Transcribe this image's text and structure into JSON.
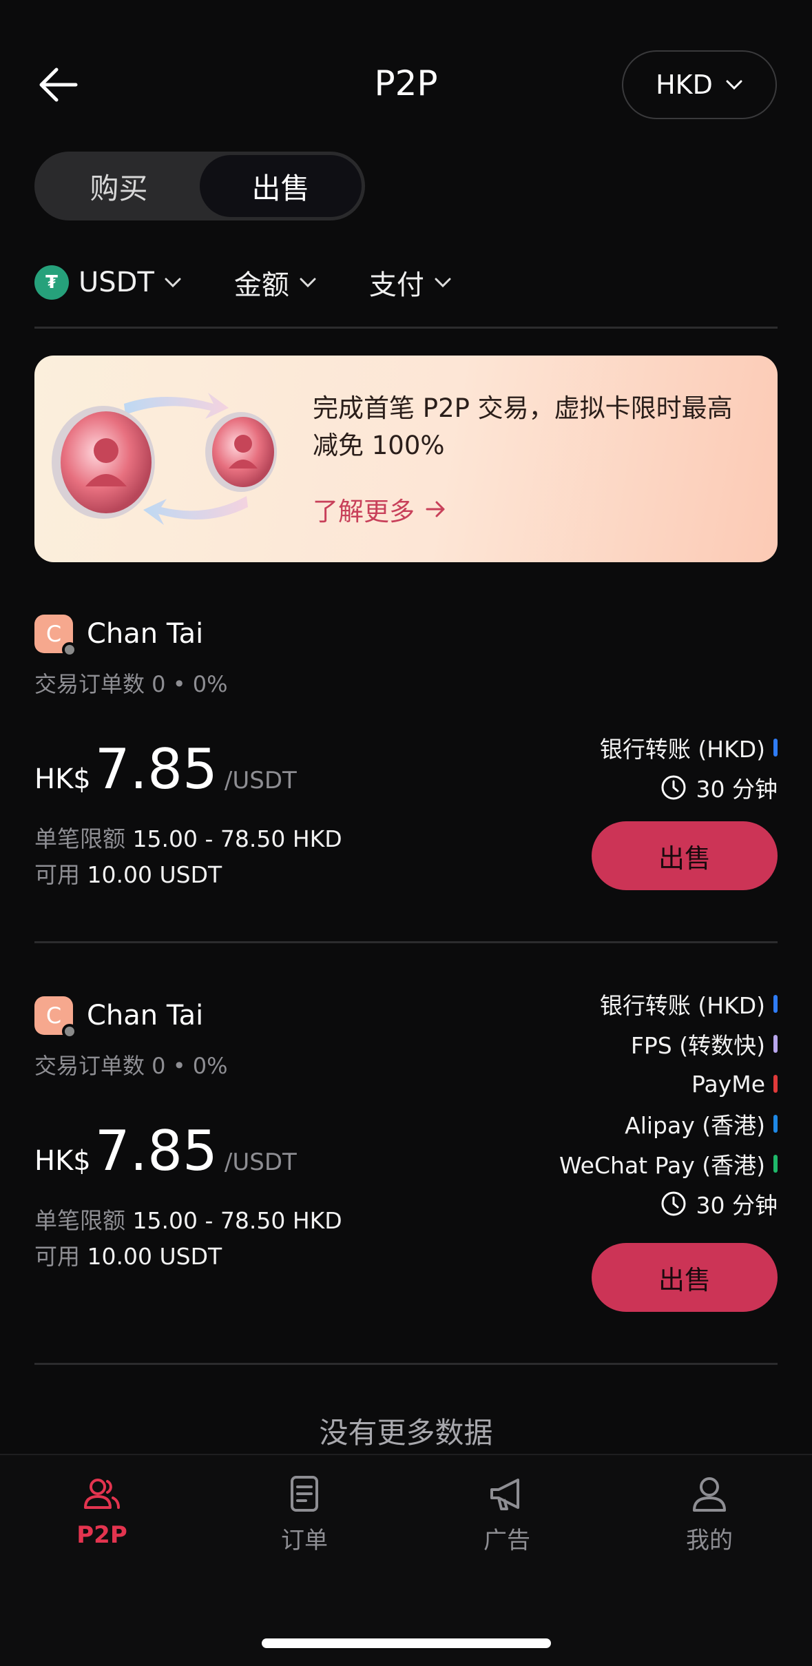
{
  "header": {
    "title": "P2P",
    "currency": "HKD"
  },
  "segment": {
    "buy_label": "购买",
    "sell_label": "出售",
    "active": "sell"
  },
  "filters": {
    "crypto": "USDT",
    "amount": "金额",
    "payment": "支付"
  },
  "banner": {
    "text": "完成首笔 P2P 交易，虚拟卡限时最高减免 100%",
    "link": "了解更多"
  },
  "listings": [
    {
      "merchant_initial": "C",
      "merchant_name": "Chan Tai",
      "stats": "交易订单数 0 • 0%",
      "currency_symbol": "HK$",
      "price": "7.85",
      "unit": "/USDT",
      "limit_label": "单笔限额",
      "limit_value": "15.00 - 78.50 HKD",
      "available_label": "可用",
      "available_value": "10.00 USDT",
      "payment_methods": [
        {
          "name": "银行转账 (HKD)",
          "color": "#2f7cf6"
        }
      ],
      "time_limit": "30 分钟",
      "action": "出售"
    },
    {
      "merchant_initial": "C",
      "merchant_name": "Chan Tai",
      "stats": "交易订单数 0 • 0%",
      "currency_symbol": "HK$",
      "price": "7.85",
      "unit": "/USDT",
      "limit_label": "单笔限额",
      "limit_value": "15.00 - 78.50 HKD",
      "available_label": "可用",
      "available_value": "10.00 USDT",
      "payment_methods": [
        {
          "name": "银行转账 (HKD)",
          "color": "#2f7cf6"
        },
        {
          "name": "FPS (转数快)",
          "color": "#b9a7ee"
        },
        {
          "name": "PayMe",
          "color": "#e03a3a"
        },
        {
          "name": "Alipay (香港)",
          "color": "#1e88e5"
        },
        {
          "name": "WeChat Pay (香港)",
          "color": "#1fb86a"
        }
      ],
      "time_limit": "30 分钟",
      "action": "出售"
    }
  ],
  "no_more": "没有更多数据",
  "tabbar": {
    "p2p": "P2P",
    "orders": "订单",
    "ads": "广告",
    "mine": "我的",
    "active_color": "#e3344f"
  }
}
